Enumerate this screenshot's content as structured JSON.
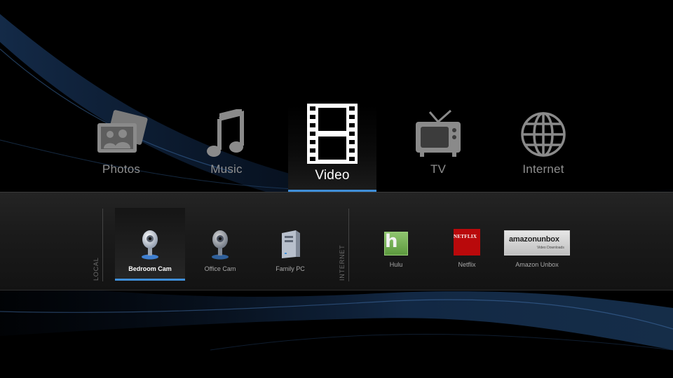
{
  "categories": [
    {
      "label": "Photos",
      "icon": "photos-icon",
      "active": false
    },
    {
      "label": "Music",
      "icon": "music-note-icon",
      "active": false
    },
    {
      "label": "Video",
      "icon": "film-strip-icon",
      "active": true
    },
    {
      "label": "TV",
      "icon": "television-icon",
      "active": false
    },
    {
      "label": "Internet",
      "icon": "globe-icon",
      "active": false
    }
  ],
  "sections": {
    "local": {
      "label": "LOCAL",
      "items": [
        {
          "label": "Bedroom Cam",
          "icon": "webcam-icon",
          "active": true
        },
        {
          "label": "Office Cam",
          "icon": "webcam-icon",
          "active": false
        },
        {
          "label": "Family PC",
          "icon": "computer-tower-icon",
          "active": false
        }
      ]
    },
    "internet": {
      "label": "INTERNET",
      "items": [
        {
          "label": "Hulu",
          "icon": "hulu-logo",
          "logo_text": "h",
          "active": false
        },
        {
          "label": "Netflix",
          "icon": "netflix-logo",
          "logo_text": "NETFLIX",
          "active": false
        },
        {
          "label": "Amazon Unbox",
          "icon": "amazon-unbox-logo",
          "logo_text": "amazonunbox",
          "logo_subtext": "Video Downloads",
          "active": false
        }
      ]
    }
  },
  "colors": {
    "accent": "#3f8ed8",
    "background": "#000000",
    "inactive_text": "#8f8f8f",
    "active_text": "#ffffff",
    "hulu_green": "#6aa84f",
    "netflix_red": "#b9090b"
  }
}
